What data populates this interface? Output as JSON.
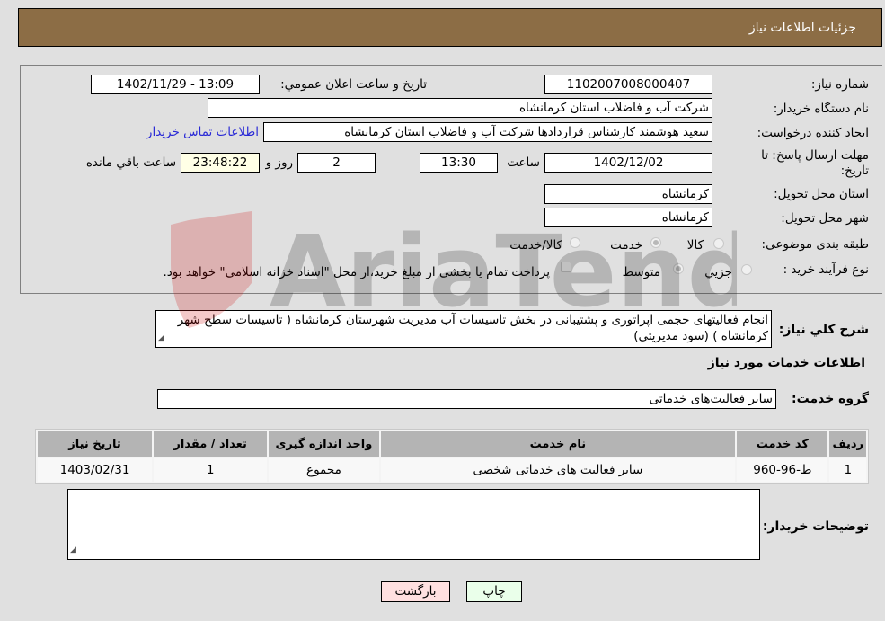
{
  "header": {
    "title": "جزئیات اطلاعات نیاز"
  },
  "info": {
    "need_number_label": "شماره نیاز:",
    "need_number": "1102007008000407",
    "announce_label": "تاریخ و ساعت اعلان عمومي:",
    "announce_value": "1402/11/29 - 13:09",
    "buyer_org_label": "نام دستگاه خريدار:",
    "buyer_org": "شرکت آب و فاضلاب استان کرمانشاه",
    "creator_label": "ايجاد کننده درخواست:",
    "creator": "سعید هوشمند کارشناس قراردادها شرکت آب و فاضلاب استان کرمانشاه",
    "contact_link": "اطلاعات تماس خريدار",
    "deadline_label": "مهلت ارسال پاسخ: تا تاريخ:",
    "deadline_date": "1402/12/02",
    "time_label": "ساعت",
    "deadline_time": "13:30",
    "days_value": "2",
    "days_label": "روز و",
    "remaining_time": "23:48:22",
    "remaining_label": "ساعت باقي مانده",
    "province_label": "استان محل تحويل:",
    "province": "کرمانشاه",
    "city_label": "شهر محل تحويل:",
    "city": "کرمانشاه",
    "category_label": "طبقه بندی موضوعی:",
    "category_options": [
      {
        "label": "کالا",
        "checked": false
      },
      {
        "label": "خدمت",
        "checked": true
      },
      {
        "label": "کالا/خدمت",
        "checked": false
      }
    ],
    "process_label": "نوع فرآيند خريد :",
    "process_options": [
      {
        "label": "جزيي",
        "checked": false
      },
      {
        "label": "متوسط",
        "checked": true
      }
    ],
    "treasury_checked": false,
    "treasury_text": "پرداخت تمام يا بخشی از مبلغ خريد،از محل \"اسناد خزانه اسلامی\" خواهد بود."
  },
  "description": {
    "label": "شرح کلي نياز:",
    "text": "انجام فعالیتهای حجمی اپراتوری و پشتیبانی در بخش تاسیسات آب مدیریت شهرستان کرمانشاه ( تاسیسات سطح شهر کرمانشاه ) (سود مدیریتی)"
  },
  "services": {
    "section_title": "اطلاعات خدمات مورد نياز",
    "group_label": "گروه خدمت:",
    "group_value": "سایر فعالیت‌های خدماتی",
    "columns": [
      "رديف",
      "کد خدمت",
      "نام خدمت",
      "واحد اندازه گيری",
      "تعداد / مقدار",
      "تاريخ نياز"
    ],
    "rows": [
      [
        "1",
        "ط-96-960",
        "سایر فعالیت های خدماتی شخصی",
        "مجموع",
        "1",
        "1403/02/31"
      ]
    ]
  },
  "buyer_notes": {
    "label": "توضيحات خريدار:",
    "text": ""
  },
  "buttons": {
    "print": "چاپ",
    "back": "بازگشت"
  },
  "watermark": {
    "text": "AriaTender.neT"
  },
  "colors": {
    "header_bg": "#8c6d45",
    "print_bg": "#eaffea",
    "back_bg": "#ffe0e0",
    "link": "#2a2ad6"
  }
}
